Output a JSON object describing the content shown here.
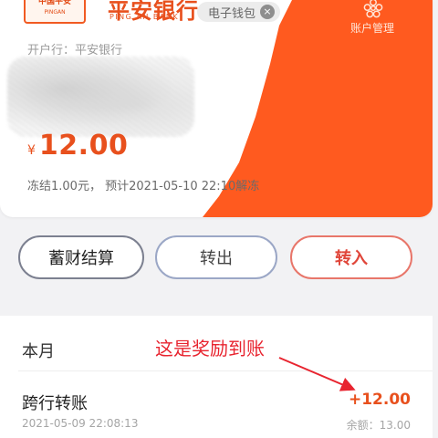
{
  "card": {
    "logo_line1": "中国平安",
    "logo_line2": "PINGAN",
    "bank_name": "平安银行",
    "bank_en": "PING AN BANK",
    "wallet_label": "电子钱包",
    "account_mgmt_label": "账户管理",
    "account_mgmt_icon": "gear-flower-icon",
    "open_bank": "开户行：平安银行",
    "currency_symbol": "¥",
    "balance": "12.00",
    "frozen_note": "冻结1.00元，  预计2021-05-10 22:10解冻"
  },
  "actions": {
    "savings": "蓄财结算",
    "transfer_out": "转出",
    "transfer_in": "转入"
  },
  "list": {
    "month": "本月",
    "annotation": "这是奖励到账",
    "transactions": [
      {
        "title": "跨行转账",
        "amount": "+12.00",
        "time": "2021-05-09 22:08:13",
        "balance": "余额：13.00"
      }
    ]
  },
  "colors": {
    "brand_orange": "#ff5a1f",
    "accent_red": "#e8242f",
    "amount_orange": "#e8501d"
  }
}
